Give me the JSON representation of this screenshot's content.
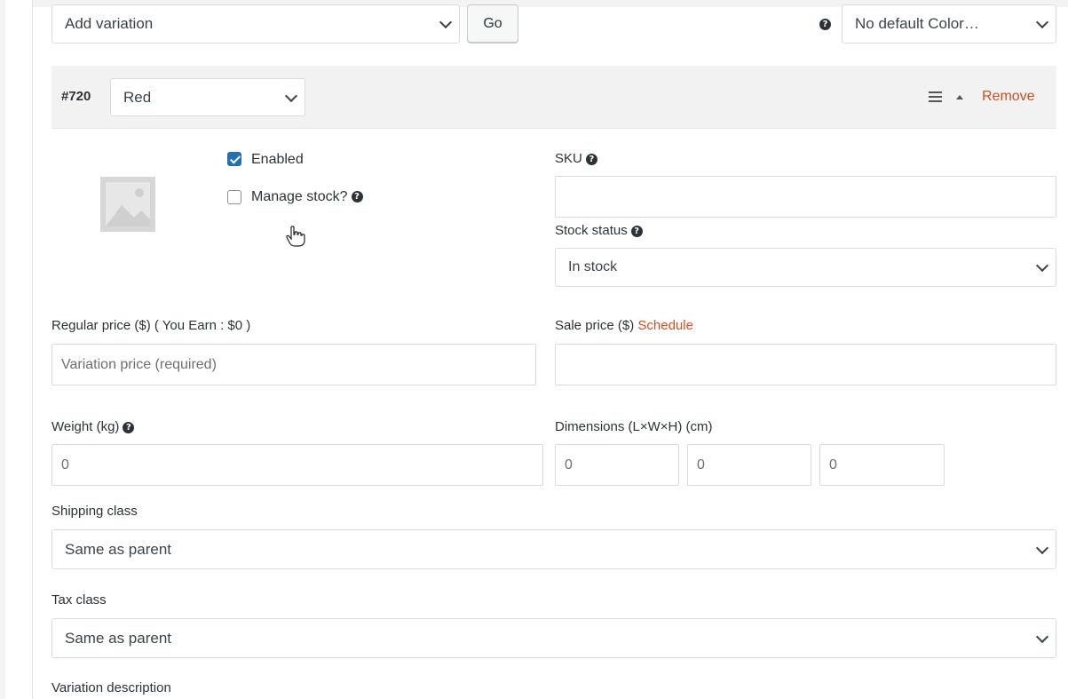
{
  "toolbar": {
    "add_variation_value": "Add variation",
    "go_label": "Go",
    "help_glyph": "?",
    "default_color_value": "No default Color…"
  },
  "variation": {
    "id_label": "#720",
    "attribute_value": "Red",
    "menu_icon": "hamburger-icon",
    "toggle_icon": "triangle-up-icon",
    "remove_label": "Remove",
    "image_placeholder_icon": "image-placeholder-icon",
    "enabled_label": "Enabled",
    "enabled_checked": true,
    "manage_stock_label": "Manage stock?",
    "manage_stock_checked": false,
    "sku_label": "SKU",
    "sku_value": "",
    "stock_status_label": "Stock status",
    "stock_status_value": "In stock",
    "regular_price_label": "Regular price ($) ( You Earn : $0 )",
    "regular_price_placeholder": "Variation price (required)",
    "sale_price_label": "Sale price ($)",
    "schedule_label": "Schedule",
    "sale_price_value": "",
    "weight_label": "Weight (kg)",
    "weight_placeholder": "0",
    "dimensions_label": "Dimensions (L×W×H) (cm)",
    "length_placeholder": "0",
    "width_placeholder": "0",
    "height_placeholder": "0",
    "shipping_class_label": "Shipping class",
    "shipping_class_value": "Same as parent",
    "tax_class_label": "Tax class",
    "tax_class_value": "Same as parent",
    "description_label": "Variation description"
  },
  "colors": {
    "accent": "#2271b1",
    "remove_link": "#d54e21",
    "header_bg": "#f2f2f2"
  }
}
